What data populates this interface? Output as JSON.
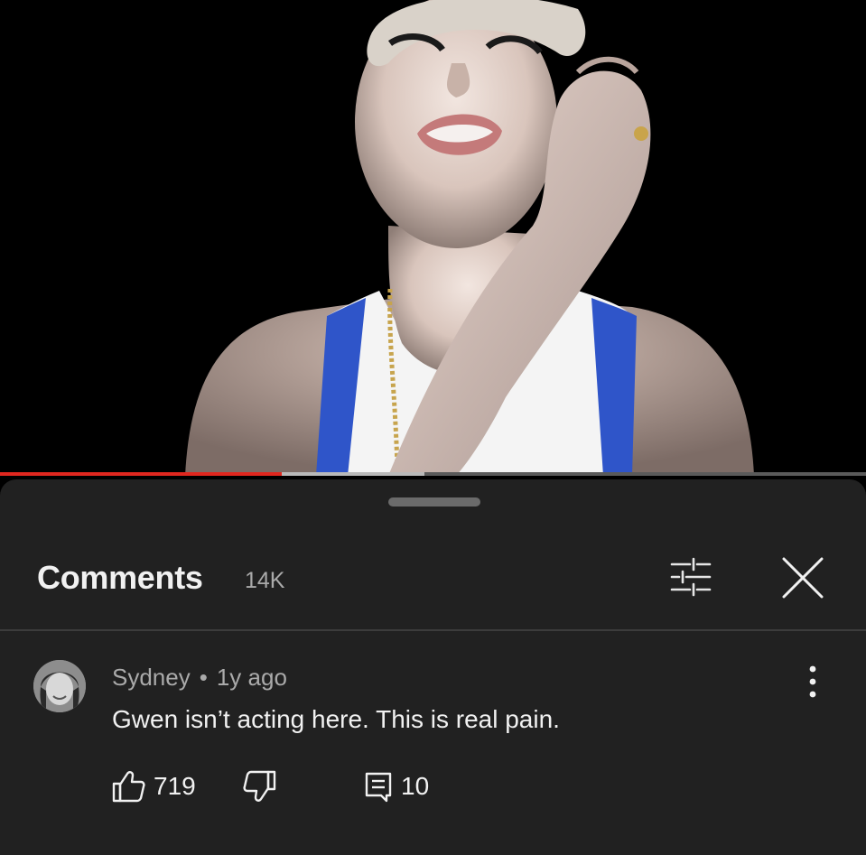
{
  "video": {
    "progress_played": 0.325,
    "progress_buffered": 0.49
  },
  "comments_panel": {
    "title": "Comments",
    "count": "14K",
    "filter_icon": "sliders-icon",
    "close_icon": "close-icon"
  },
  "comment": {
    "author": "Sydney",
    "separator": "•",
    "time": "1y ago",
    "text": "Gwen isn’t acting here. This is real pain.",
    "likes": "719",
    "replies": "10",
    "like_icon": "thumbs-up-icon",
    "dislike_icon": "thumbs-down-icon",
    "reply_icon": "reply-icon",
    "more_icon": "more-vertical-icon"
  },
  "colors": {
    "sheet_bg": "#212121",
    "progress_played": "#e0271f",
    "secondary_text": "#aaaaaa",
    "primary_text": "#f1f1f1"
  }
}
